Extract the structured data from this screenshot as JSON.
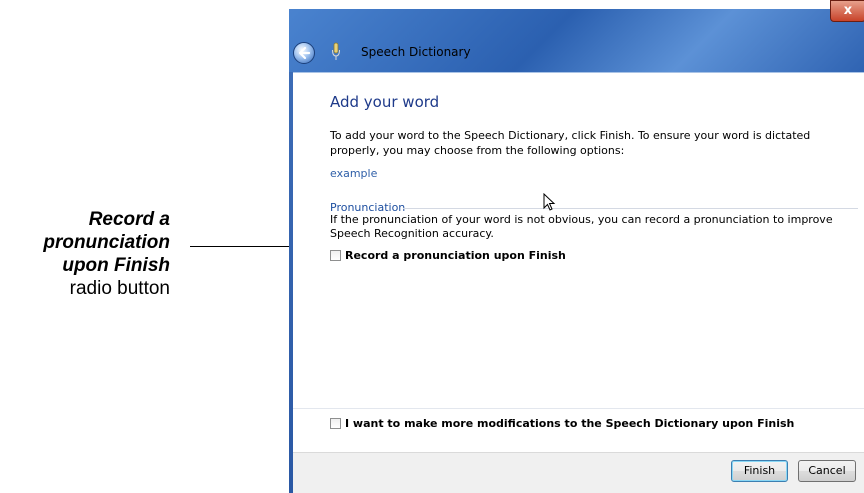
{
  "callout": {
    "line1": "Record a",
    "line2": "pronunciation",
    "line3": "upon Finish",
    "line4": "radio button"
  },
  "window": {
    "title": "Speech Dictionary",
    "close_glyph": "x",
    "back_icon": "back-arrow-icon",
    "app_icon": "microphone-icon"
  },
  "content": {
    "heading": "Add your word",
    "intro": "To add your word to the Speech Dictionary, click Finish.  To ensure your word is dictated properly, you may choose from the following options:",
    "word": "example",
    "pronunciation_group_label": "Pronunciation",
    "pronunciation_text": "If the pronunciation of your word is not obvious, you can record a pronunciation to improve Speech Recognition accuracy.",
    "record_checkbox_label": "Record a pronunciation upon Finish",
    "record_checked": false,
    "modify_checkbox_label": "I want to make more modifications to the Speech Dictionary upon Finish",
    "modify_checked": false
  },
  "footer": {
    "finish_label": "Finish",
    "cancel_label": "Cancel"
  },
  "colors": {
    "titlebar": "#2b60b0",
    "heading": "#1e3a8a",
    "link": "#2f5fa8"
  }
}
